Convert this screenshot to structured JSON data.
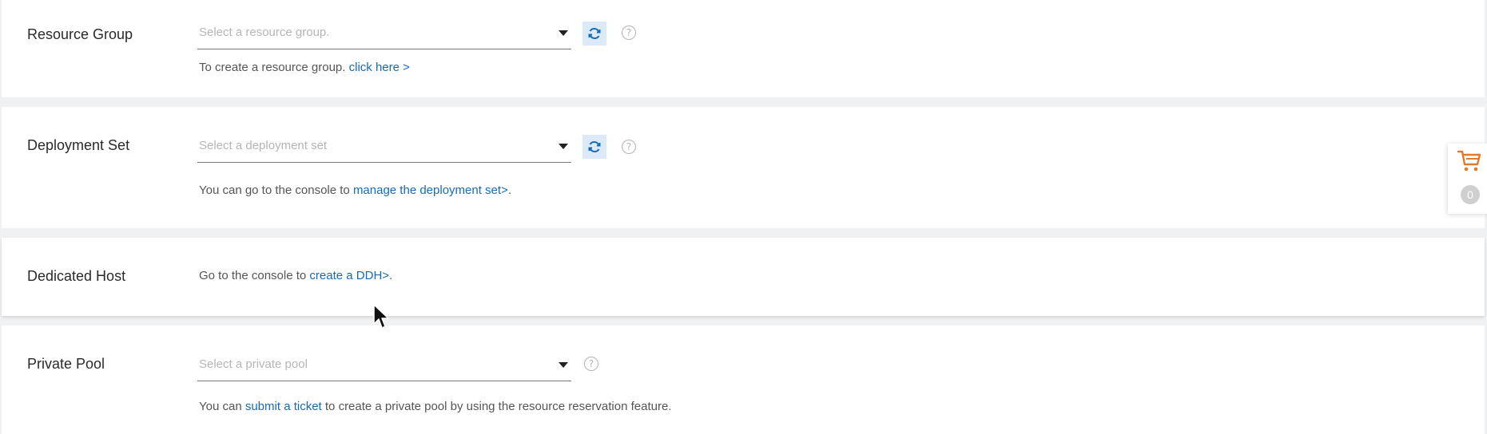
{
  "resource_group": {
    "label": "Resource Group",
    "placeholder": "Select a resource group.",
    "hint_prefix": "To create a resource group. ",
    "hint_link": "click here >",
    "hint_suffix": ""
  },
  "deployment_set": {
    "label": "Deployment Set",
    "placeholder": "Select a deployment set",
    "hint_prefix": "You can go to the console to ",
    "hint_link": "manage the deployment set>",
    "hint_suffix": "."
  },
  "dedicated_host": {
    "label": "Dedicated Host",
    "hint_prefix": "Go to the console to ",
    "hint_link": "create a DDH>",
    "hint_suffix": "."
  },
  "private_pool": {
    "label": "Private Pool",
    "placeholder": "Select a private pool",
    "hint_prefix": "You can ",
    "hint_link": "submit a ticket",
    "hint_suffix": " to create a private pool by using the resource reservation feature."
  },
  "help_glyph": "?",
  "cart": {
    "icon": "shopping-cart-icon",
    "count": "0",
    "color": "#e07a2e"
  },
  "colors": {
    "link": "#1a6ab3",
    "refresh_bg": "#dbe9f8",
    "refresh_icon": "#1a6ab3"
  }
}
